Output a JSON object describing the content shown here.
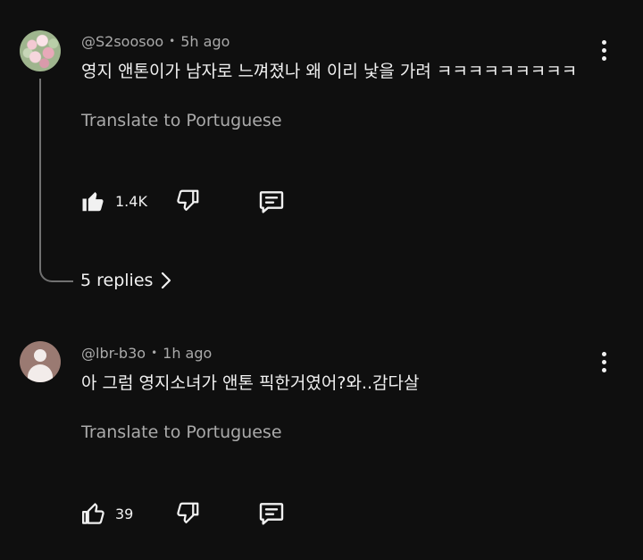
{
  "comments": [
    {
      "handle": "@S2soosoo",
      "time": "5h ago",
      "separator": "•",
      "text": "영지 앤톤이가 남자로 느껴졌나 왜 이리 낯을 가려 ㅋㅋㅋㅋㅋㅋㅋㅋㅋ",
      "translate": "Translate to Portuguese",
      "likes": "1.4K",
      "liked": true,
      "replies_label": "5 replies",
      "avatar_icon": "flower-photo-avatar"
    },
    {
      "handle": "@lbr-b3o",
      "time": "1h ago",
      "separator": "•",
      "text": "아 그럼 영지소녀가 앤톤 픽한거였어?와..감다살",
      "translate": "Translate to Portuguese",
      "likes": "39",
      "liked": false,
      "avatar_icon": "default-user-avatar"
    }
  ],
  "colors": {
    "background": "#0f0f0f",
    "primary_text": "#f1f1f1",
    "secondary_text": "#aaaaaa",
    "thread_line": "#717171"
  }
}
